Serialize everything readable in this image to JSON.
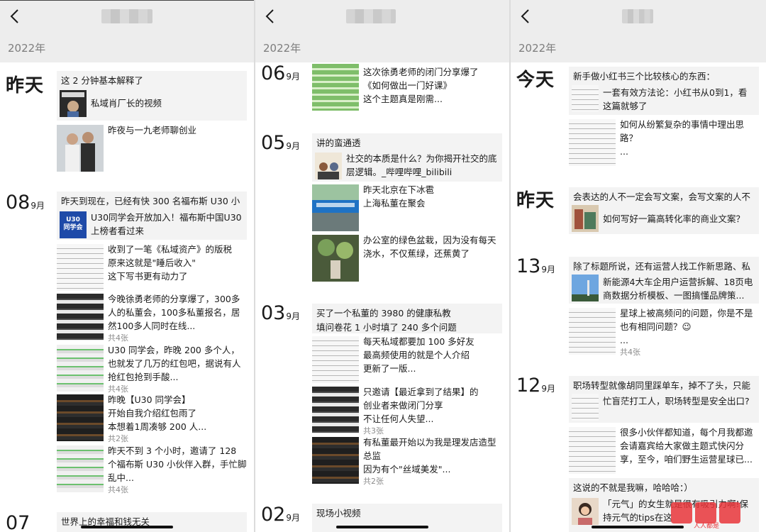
{
  "panels": [
    {
      "year": "2022年",
      "groups": [
        {
          "day_label": "昨天",
          "items": [
            {
              "kind": "share",
              "head": "这 2 分钟基本解释了",
              "text": "私域肖厂长的视频"
            },
            {
              "kind": "post",
              "text": "昨夜与一九老师聊创业",
              "count": ""
            }
          ]
        },
        {
          "date_num": "08",
          "date_month": "9月",
          "items": [
            {
              "kind": "share",
              "head": "昨天到现在，已经有快 300 名福布斯 U30 小",
              "text": "U30同学会开放加入！福布斯中国U30上榜者看过来",
              "thumb_text": "U30\n同学会"
            },
            {
              "kind": "post",
              "text": "收到了一笔《私域资产》的版税\n原来这就是\"睡后收入\"\n这下写书更有动力了",
              "count": ""
            },
            {
              "kind": "post",
              "text": "今晚徐勇老师的分享爆了，300多人的私董会，100多私董报名，居然100多人同时在线...",
              "count": "共4张"
            },
            {
              "kind": "post",
              "text": "U30 同学会，昨晚 200 多个人，也就发了几万的红包吧，据说有人抢红包抢到手酸...",
              "count": "共4张"
            },
            {
              "kind": "post",
              "text": "昨晚【U30 同学会】\n开始自我介绍红包雨了\n本想着1周凑够 200 人...",
              "count": "共2张"
            },
            {
              "kind": "post",
              "text": "昨天不到 3 个小时，邀请了 128 个福布斯 U30 小伙伴入群，手忙脚乱中...",
              "count": "共4张"
            }
          ]
        },
        {
          "date_num": "07",
          "items": [
            {
              "kind": "share",
              "head": "世界上的幸福和钱无关"
            }
          ]
        }
      ]
    },
    {
      "year": "2022年",
      "groups": [
        {
          "date_num": "06",
          "date_month": "9月",
          "items": [
            {
              "kind": "post",
              "text": "这次徐勇老师的闭门分享爆了\n《如何做出一门好课》\n这个主题真是刚需...",
              "count": ""
            }
          ]
        },
        {
          "date_num": "05",
          "date_month": "9月",
          "items": [
            {
              "kind": "share",
              "head": "讲的蛮通透",
              "text": "社交的本质是什么？为你揭开社交的底层逻辑。_哔哩哔哩_bilibili"
            },
            {
              "kind": "post",
              "text": "昨天北京在下冰雹\n上海私董在聚会",
              "count": ""
            },
            {
              "kind": "post",
              "text": "办公室的绿色盆栽，因为没有每天浇水，不仅蕉绿，还蕉黄了",
              "count": ""
            }
          ]
        },
        {
          "date_num": "03",
          "date_month": "9月",
          "items": [
            {
              "kind": "share",
              "head": "买了一个私董的 3980 的健康私教\n填问卷花 1 小时填了 240 多个问题"
            },
            {
              "kind": "post",
              "text": "每天私域都要加 100 多好友\n最高频使用的就是个人介绍\n更新了一版...",
              "count": ""
            },
            {
              "kind": "post",
              "text": "只邀请【最近拿到了结果】的\n创业者来做闭门分享\n不让任何人失望...",
              "count": "共3张"
            },
            {
              "kind": "post",
              "text": "有私董最开始以为我是理发店造型总监\n因为有个\"丝域美发\"...",
              "count": "共2张"
            }
          ]
        },
        {
          "date_num": "02",
          "date_month": "9月",
          "items": [
            {
              "kind": "share",
              "head": "现场小视频"
            }
          ]
        }
      ]
    },
    {
      "year": "2022年",
      "groups": [
        {
          "day_label": "今天",
          "items": [
            {
              "kind": "share",
              "head": "新手做小红书三个比较核心的东西：",
              "text": "一套有效方法论：小红书从0到1，看这篇就够了"
            },
            {
              "kind": "post",
              "text": "如何从纷繁复杂的事情中理出思路？\n...",
              "count": ""
            }
          ]
        },
        {
          "day_label": "昨天",
          "items": [
            {
              "kind": "share",
              "head": "会表达的人不一定会写文案，会写文案的人不",
              "text": "如何写好一篇高转化率的商业文案？"
            }
          ]
        },
        {
          "date_num": "13",
          "date_month": "9月",
          "items": [
            {
              "kind": "share",
              "head": "除了标题所说，还有运营人找工作新思路、私",
              "text": "新能源4大车企用户运营拆解、18页电商数据分析模板、一图搞懂品牌策..."
            },
            {
              "kind": "post",
              "text": "星球上被高频问的问题，你是不是也有相同问题？😉\n...",
              "count": "共4张"
            }
          ]
        },
        {
          "date_num": "12",
          "date_month": "9月",
          "items": [
            {
              "kind": "share",
              "head": "职场转型就像胡同里踩单车，掉不了头，只能",
              "text": "忙盲茫打工人，职场转型是安全出口?"
            },
            {
              "kind": "post",
              "text": "很多小伙伴都知道，每个月我都邀会请嘉宾给大家做主题式快闪分享，至今，咱们野生运营星球已...",
              "count": ""
            },
            {
              "kind": "share",
              "head": "这说的不就是我嘛，哈哈哈：）",
              "text": "「元气」的女生就是很有吸引力啊!保持元气的tips在这"
            }
          ]
        }
      ]
    }
  ],
  "watermark": "人人都是"
}
